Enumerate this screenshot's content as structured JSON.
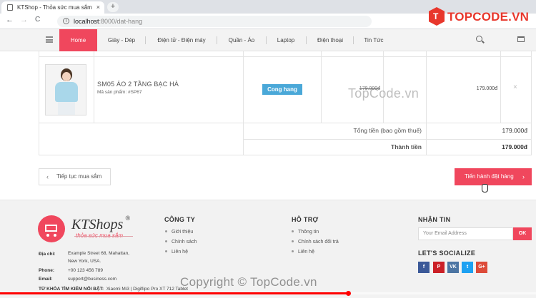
{
  "browser": {
    "tab_title": "KTShop - Thỏa sức mua sắm",
    "tab_close": "×",
    "new_tab": "+",
    "back": "←",
    "forward": "→",
    "reload": "C",
    "url_host": "localhost",
    "url_path": ":8000/dat-hang",
    "info_icon": "i"
  },
  "watermark": {
    "brand": "TOPCODE.VN",
    "brand_icon_letter": "T",
    "center": "TopCode.vn",
    "bottom": "Copyright © TopCode.vn"
  },
  "nav": {
    "items": [
      {
        "label": "Home",
        "active": true
      },
      {
        "label": "Giày - Dép"
      },
      {
        "label": "Điện tử - Điện máy"
      },
      {
        "label": "Quần - Áo"
      },
      {
        "label": "Laptop"
      },
      {
        "label": "Điện thoại"
      },
      {
        "label": "Tin Tức"
      }
    ]
  },
  "cart": {
    "product_name": "SM05 ÁO 2 TẦNG BẠC HÀ",
    "product_sku": "Mã sản phẩm: #SP67",
    "badge": "Cong hang",
    "old_price": "179.000đ",
    "line_total": "179.000đ",
    "remove": "×",
    "subtotal_label": "Tổng tiền (bao gồm thuế)",
    "subtotal_value": "179.000đ",
    "total_label": "Thành tiền",
    "total_value": "179.000đ"
  },
  "actions": {
    "back_chev": "‹",
    "back_label": "Tiếp tục mua sắm",
    "order_label": "Tiến hành đặt hàng",
    "order_chev": "›"
  },
  "footer": {
    "brand": "KTShops",
    "brand_mark": "®",
    "slogan": "thỏa sức mua sắm",
    "address_label": "Địa chỉ:",
    "address_line1": "Example Street 68, Mahattan,",
    "address_line2": "New York, USA.",
    "phone_label": "Phone:",
    "phone": "+00 123 456 789",
    "email_label": "Email:",
    "email": "support@business.com",
    "company_title": "CÔNG TY",
    "company_links": [
      "Giới thiệu",
      "Chính sách",
      "Liên hệ"
    ],
    "support_title": "HỖ TRỢ",
    "support_links": [
      "Thông tin",
      "Chính sách đổi trả",
      "Liên hệ"
    ],
    "newsletter_title": "NHẬN TIN",
    "email_placeholder": "Your Email Address",
    "ok_label": "OK",
    "social_title": "LET'S SOCIALIZE",
    "social": [
      {
        "label": "f",
        "color": "#3b5998"
      },
      {
        "label": "P",
        "color": "#cb2027"
      },
      {
        "label": "VK",
        "color": "#4c75a3"
      },
      {
        "label": "t",
        "color": "#1da1f2"
      },
      {
        "label": "G+",
        "color": "#dd4b39"
      }
    ],
    "keywords_label": "TỪ KHÓA TÌM KIẾM NỔI BẬT:",
    "keywords": "Xiaomi Mi3 | Digiflipo Pro XT 712 Tablet"
  },
  "video": {
    "progress": 0.65
  }
}
